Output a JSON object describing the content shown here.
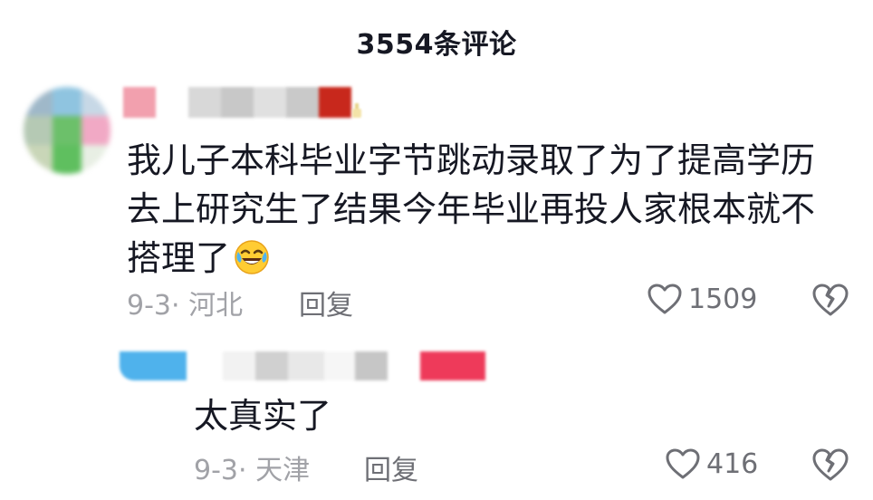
{
  "header": {
    "title": "3554条评论"
  },
  "comments": [
    {
      "text": "我儿子本科毕业字节跳动录取了为了提高学历去上研究生了结果今年毕业再投人家根本就不搭理了",
      "emoji": "laughing-crying-emoji",
      "date_location": "9-3· 河北",
      "reply_label": "回复",
      "like_count": "1509"
    }
  ],
  "replies": [
    {
      "text": "太真实了",
      "date_location": "9-3· 天津",
      "reply_label": "回复",
      "like_count": "416"
    }
  ],
  "icons": {
    "like": "heart-outline-icon",
    "dislike": "broken-heart-icon"
  },
  "colors": {
    "text_primary": "#161823",
    "text_secondary": "#a1a2a7",
    "action": "#6e6f75"
  }
}
